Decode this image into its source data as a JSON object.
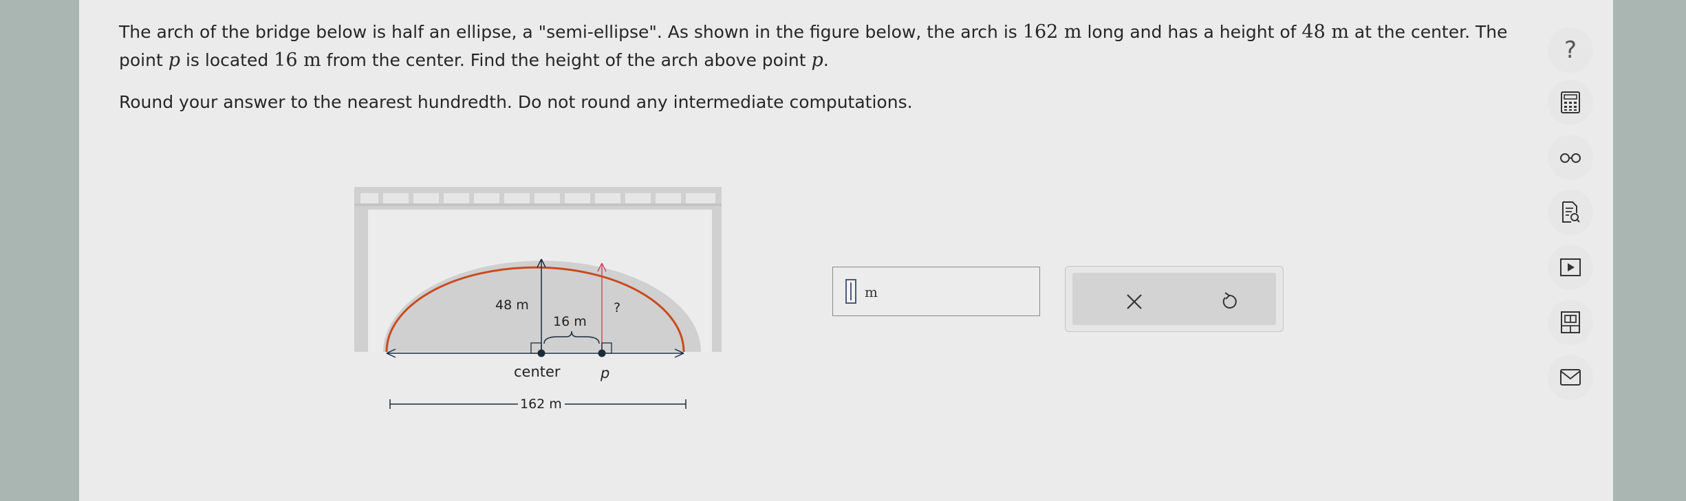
{
  "question": {
    "p1_part1": "The arch of the bridge below is half an ellipse, a \"semi-ellipse\". As shown in the figure below, the arch is ",
    "length_value": "162 m",
    "p1_part2": " long and has a height of ",
    "height_value": "48 m",
    "p1_part3": " at the center. The point ",
    "point_var": "p",
    "p1_part4": " is located ",
    "distance_value": "16 m",
    "p1_part5": " from the center. Find the height of the arch above point ",
    "point_var2": "p",
    "p1_part6": ".",
    "instruction": "Round your answer to the nearest hundredth. Do not round any intermediate computations."
  },
  "figure": {
    "height_label": "48 m",
    "distance_label": "16 m",
    "unknown_label": "?",
    "center_label": "center",
    "point_label": "p",
    "span_label": "162 m"
  },
  "answer": {
    "value": "",
    "unit": "m"
  },
  "actions": {
    "clear": "×",
    "undo": "↺"
  },
  "sidebar": {
    "help": "?"
  },
  "colors": {
    "arch": "#c84a1e",
    "marker": "#cf4a63",
    "accent": "#1b2b3a"
  }
}
